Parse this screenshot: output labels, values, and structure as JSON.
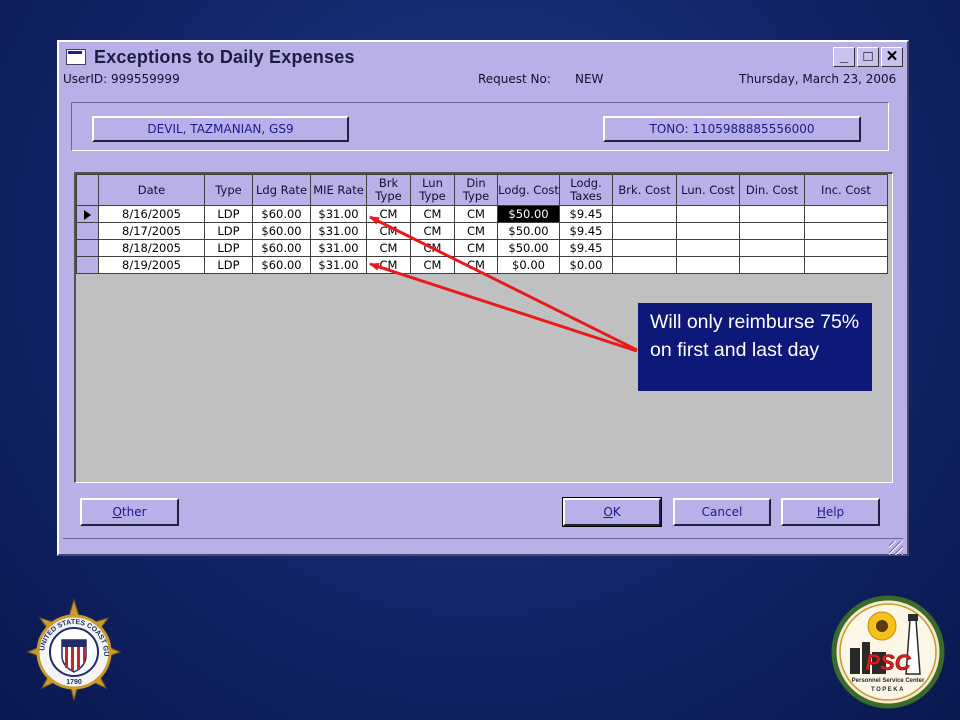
{
  "window": {
    "title": "Exceptions to Daily Expenses",
    "userid": "UserID: 999559999",
    "request_label": "Request No:",
    "request_value": "NEW",
    "date": "Thursday, March 23, 2006"
  },
  "window_buttons": {
    "minimize": "_",
    "maximize": "□",
    "close": "✕"
  },
  "header_buttons": {
    "member": "DEVIL, TAZMANIAN, GS9",
    "tono": "TONO: 1105988885556000"
  },
  "grid": {
    "columns": [
      "Date",
      "Type",
      "Ldg Rate",
      "MIE Rate",
      "Brk Type",
      "Lun Type",
      "Din Type",
      "Lodg. Cost",
      "Lodg. Taxes",
      "Brk. Cost",
      "Lun. Cost",
      "Din. Cost",
      "Inc. Cost"
    ],
    "rows": [
      [
        "8/16/2005",
        "LDP",
        "$60.00",
        "$31.00",
        "CM",
        "CM",
        "CM",
        "$50.00",
        "$9.45",
        "",
        "",
        "",
        ""
      ],
      [
        "8/17/2005",
        "LDP",
        "$60.00",
        "$31.00",
        "CM",
        "CM",
        "CM",
        "$50.00",
        "$9.45",
        "",
        "",
        "",
        ""
      ],
      [
        "8/18/2005",
        "LDP",
        "$60.00",
        "$31.00",
        "CM",
        "CM",
        "CM",
        "$50.00",
        "$9.45",
        "",
        "",
        "",
        ""
      ],
      [
        "8/19/2005",
        "LDP",
        "$60.00",
        "$31.00",
        "CM",
        "CM",
        "CM",
        "$0.00",
        "$0.00",
        "",
        "",
        "",
        ""
      ]
    ],
    "current_row": 0,
    "highlighted_cell": {
      "row": 0,
      "column": 7
    }
  },
  "buttons": {
    "other": {
      "accel": "O",
      "rest": "ther"
    },
    "ok": {
      "accel": "O",
      "rest": "K"
    },
    "cancel": "Cancel",
    "help": {
      "accel": "H",
      "rest": "elp"
    }
  },
  "callout": {
    "text": "Will only reimburse 75% on first and last day"
  },
  "logos": {
    "left": {
      "text": "UNITED STATES COAST GUARD",
      "year": "1790"
    },
    "right": {
      "abbr": "PSC",
      "text": "Personnel Service Center",
      "sub": "TOPEKA"
    }
  },
  "colors": {
    "background": "#14286f",
    "window": "#b8b0e6",
    "callout": "#0d1878",
    "arrow": "#e81a1a",
    "button_text": "#1a1a90"
  }
}
